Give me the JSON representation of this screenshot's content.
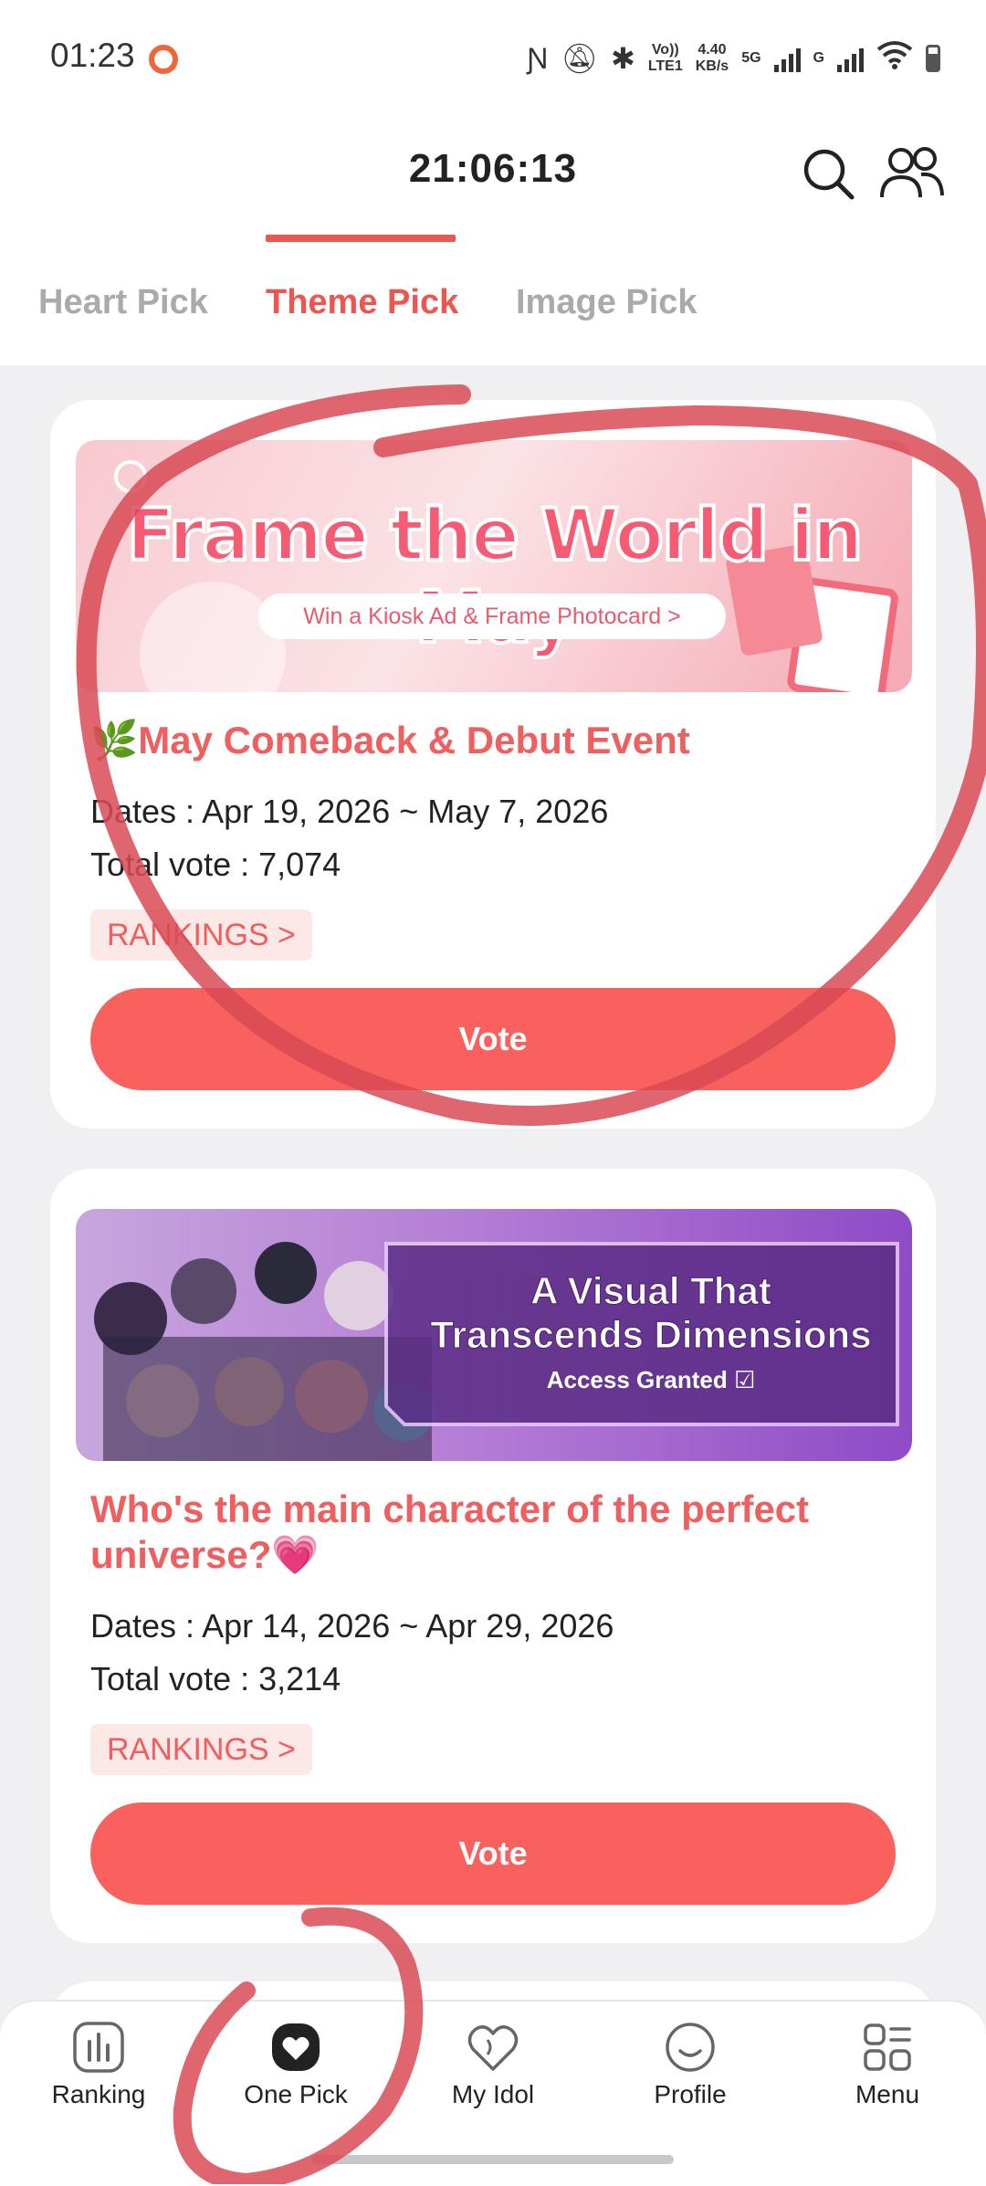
{
  "status_bar": {
    "time": "01:23",
    "speed_value": "4.40",
    "speed_unit": "KB/s",
    "volte_top": "Vo))",
    "volte_bottom": "LTE1",
    "network_5g": "5G",
    "network_g": "G"
  },
  "header": {
    "timer": "21:06:13",
    "tabs": [
      {
        "label": "Heart Pick"
      },
      {
        "label": "Theme Pick"
      },
      {
        "label": "Image Pick"
      }
    ]
  },
  "cards": [
    {
      "banner_title": "Frame the World in May",
      "banner_subtitle": "Win a Kiosk Ad & Frame Photocard >",
      "title": "🌿May Comeback & Debut Event",
      "dates": "Dates : Apr 19, 2026 ~ May 7, 2026",
      "total_vote": "Total vote : 7,074",
      "rankings_label": "RANKINGS >",
      "vote_label": "Vote"
    },
    {
      "banner_title_line1": "A Visual That",
      "banner_title_line2": "Transcends Dimensions",
      "banner_subtitle": "Access Granted ☑",
      "title": "Who's the main character of the perfect universe?💗",
      "dates": "Dates : Apr 14, 2026 ~ Apr 29, 2026",
      "total_vote": "Total vote : 3,214",
      "rankings_label": "RANKINGS >",
      "vote_label": "Vote"
    }
  ],
  "bottom_nav": [
    {
      "label": "Ranking",
      "icon": "ranking-icon"
    },
    {
      "label": "One Pick",
      "icon": "heart-filled-icon"
    },
    {
      "label": "My Idol",
      "icon": "heart-outline-icon"
    },
    {
      "label": "Profile",
      "icon": "smile-icon"
    },
    {
      "label": "Menu",
      "icon": "grid-menu-icon"
    }
  ],
  "colors": {
    "accent": "#f0544f",
    "vote_button": "#f8615e",
    "annotation_stroke": "#d94a55"
  }
}
